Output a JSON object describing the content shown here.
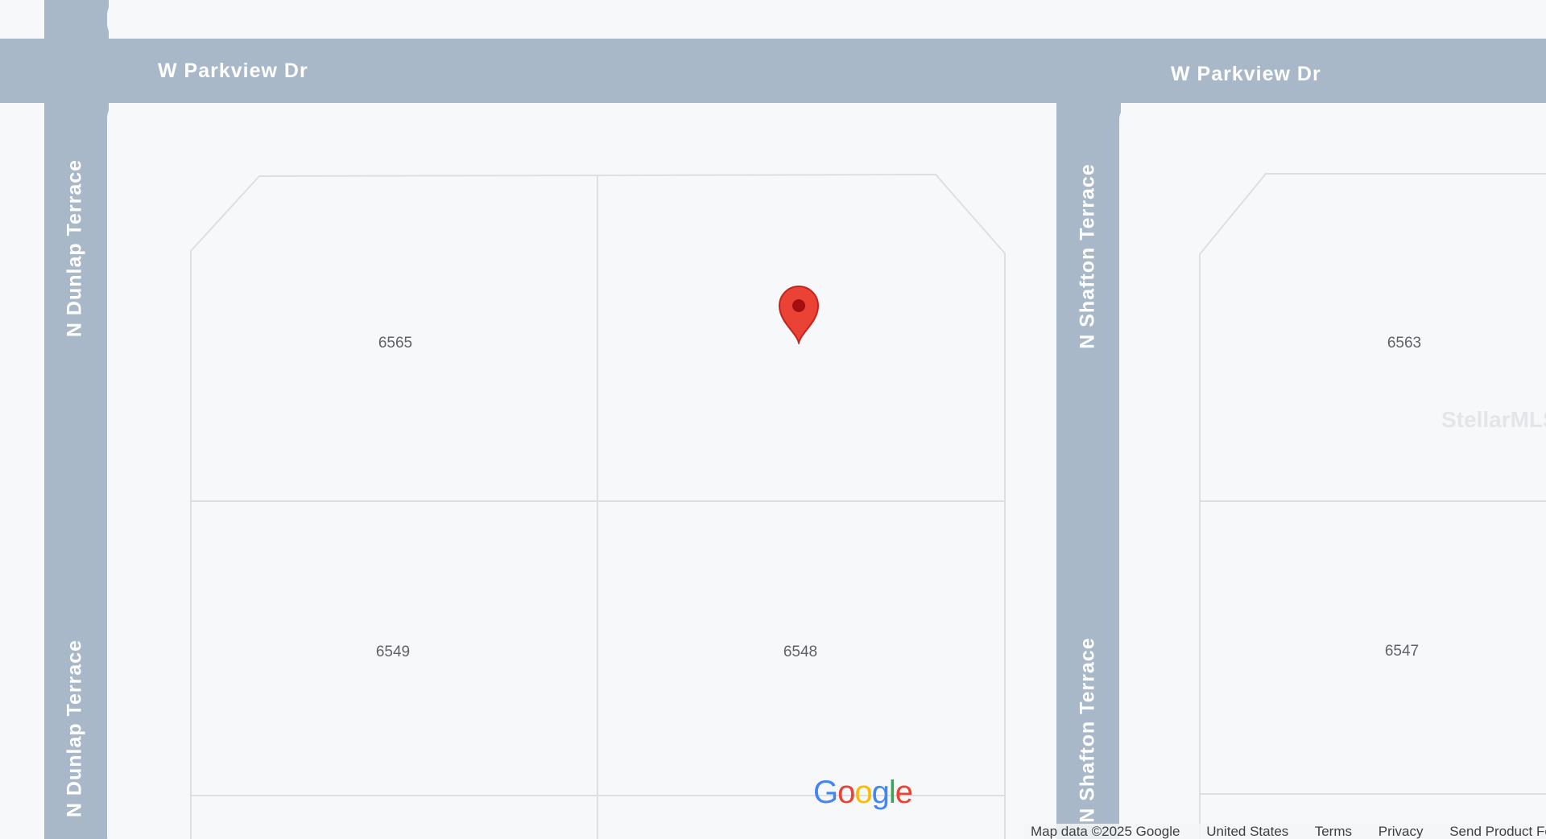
{
  "roads": {
    "parkview_left": "W Parkview Dr",
    "parkview_right": "W Parkview Dr",
    "dunlap_top": "N Dunlap Terrace",
    "dunlap_bottom": "N Dunlap Terrace",
    "shafton_top": "N Shafton Terrace",
    "shafton_bottom": "N Shafton Terrace"
  },
  "lots": {
    "lot_6565": "6565",
    "lot_6563": "6563",
    "lot_6549": "6549",
    "lot_6548": "6548",
    "lot_6547": "6547"
  },
  "watermark": "StellarMLS",
  "google_logo": {
    "g1": "G",
    "o1": "o",
    "o2": "o",
    "g2": "g",
    "l": "l",
    "e": "e"
  },
  "attribution": {
    "map_data": "Map data ©2025 Google",
    "country": "United States",
    "terms": "Terms",
    "privacy": "Privacy",
    "send_product": "Send Product Feedback"
  },
  "colors": {
    "road": "#a9b8c9",
    "land": "#f7f8f9",
    "lot_line": "#dcdfe3",
    "marker": "#ea4335",
    "marker_dot": "#a50e0e",
    "google_blue": "#4285f4",
    "google_red": "#ea4335",
    "google_yellow": "#fbbc05",
    "google_green": "#34a853"
  },
  "icons": {
    "marker": "map-pin-icon",
    "logo": "google-logo"
  }
}
